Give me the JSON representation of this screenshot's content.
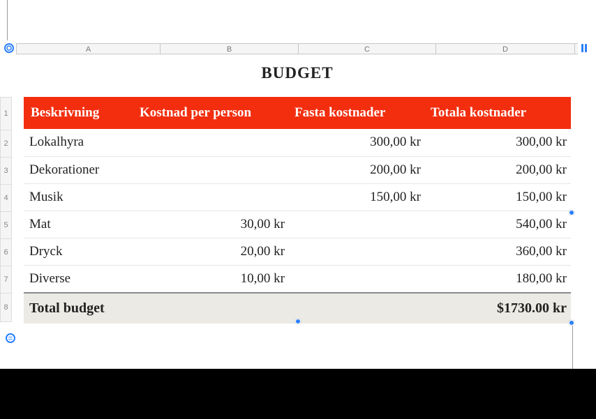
{
  "title": "BUDGET",
  "columns": [
    "A",
    "B",
    "C",
    "D"
  ],
  "row_numbers": [
    "1",
    "2",
    "3",
    "4",
    "5",
    "6",
    "7",
    "8"
  ],
  "header": {
    "c1": "Beskrivning",
    "c2": "Kostnad per person",
    "c3": "Fasta kostnader",
    "c4": "Totala kostnader"
  },
  "rows": [
    {
      "desc": "Lokalhyra",
      "pp": "",
      "fixed": "300,00 kr",
      "total": "300,00 kr"
    },
    {
      "desc": "Dekorationer",
      "pp": "",
      "fixed": "200,00 kr",
      "total": "200,00 kr"
    },
    {
      "desc": "Musik",
      "pp": "",
      "fixed": "150,00 kr",
      "total": "150,00 kr"
    },
    {
      "desc": "Mat",
      "pp": "30,00 kr",
      "fixed": "",
      "total": "540,00 kr"
    },
    {
      "desc": "Dryck",
      "pp": "20,00 kr",
      "fixed": "",
      "total": "360,00 kr"
    },
    {
      "desc": "Diverse",
      "pp": "10,00 kr",
      "fixed": "",
      "total": "180,00 kr"
    }
  ],
  "footer": {
    "label": "Total budget",
    "value": "$1730.00 kr"
  },
  "chart_data": {
    "type": "table",
    "title": "BUDGET",
    "columns": [
      "Beskrivning",
      "Kostnad per person",
      "Fasta kostnader",
      "Totala kostnader"
    ],
    "rows": [
      [
        "Lokalhyra",
        "",
        "300,00 kr",
        "300,00 kr"
      ],
      [
        "Dekorationer",
        "",
        "200,00 kr",
        "200,00 kr"
      ],
      [
        "Musik",
        "",
        "150,00 kr",
        "150,00 kr"
      ],
      [
        "Mat",
        "30,00 kr",
        "",
        "540,00 kr"
      ],
      [
        "Dryck",
        "20,00 kr",
        "",
        "360,00 kr"
      ],
      [
        "Diverse",
        "10,00 kr",
        "",
        "180,00 kr"
      ],
      [
        "Total budget",
        "",
        "",
        "$1730.00 kr"
      ]
    ]
  }
}
